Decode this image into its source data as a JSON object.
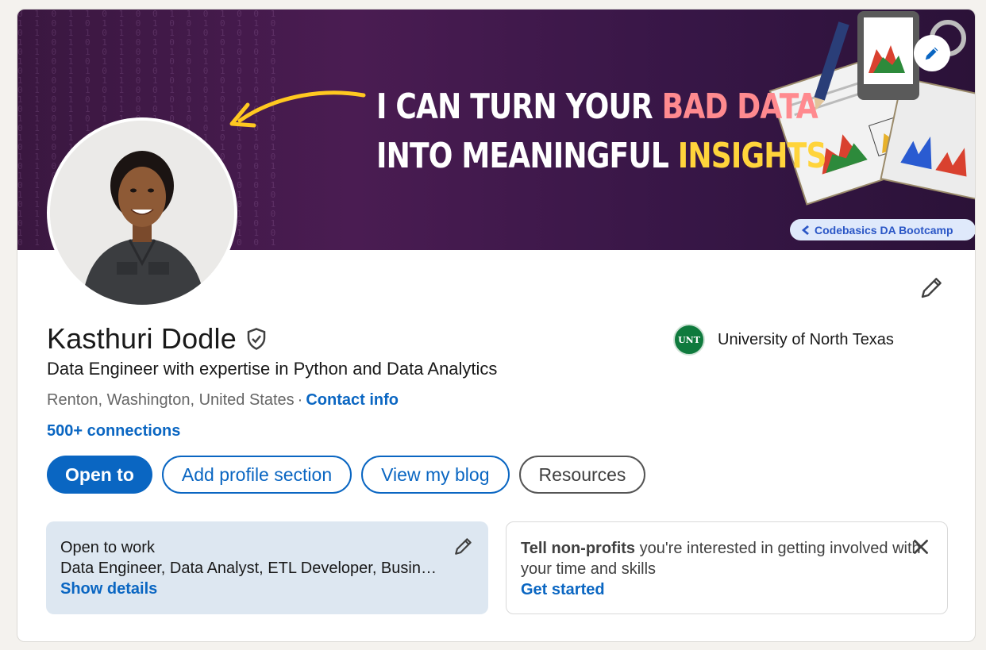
{
  "banner": {
    "headline_line1_white": "I CAN TURN YOUR ",
    "headline_line1_red": "BAD DATA",
    "headline_line2_white": "INTO MEANINGFUL ",
    "headline_line2_yellow": "INSIGHTS",
    "badge_label": "Codebasics DA Bootcamp",
    "binary_text": "0 1 0 1 1 0 1 0 0 1 1 0 1 0 0 1 0 1 1 0 1 0 1 1"
  },
  "profile": {
    "name": "Kasthuri Dodle",
    "headline": "Data Engineer with expertise in Python and Data Analytics",
    "location": "Renton, Washington, United States",
    "separator": "·",
    "contact_label": "Contact info",
    "connections": "500+ connections"
  },
  "education": {
    "logo_text": "UNT",
    "name": "University of North Texas"
  },
  "actions": {
    "open_to": "Open to",
    "add_section": "Add profile section",
    "view_blog": "View my blog",
    "resources": "Resources"
  },
  "open_to_work": {
    "title": "Open to work",
    "roles": "Data Engineer, Data Analyst, ETL Developer, Business Analyst",
    "link": "Show details"
  },
  "nonprofit": {
    "bold": "Tell non-profits",
    "rest": " you're interested in getting involved with your time and skills",
    "link": "Get started"
  },
  "colors": {
    "brand_blue": "#0a66c2",
    "banner_purple": "#4a1c52",
    "headline_red": "#ff8a8f",
    "headline_yellow": "#ffd43b",
    "unt_green": "#0f7a3d"
  }
}
